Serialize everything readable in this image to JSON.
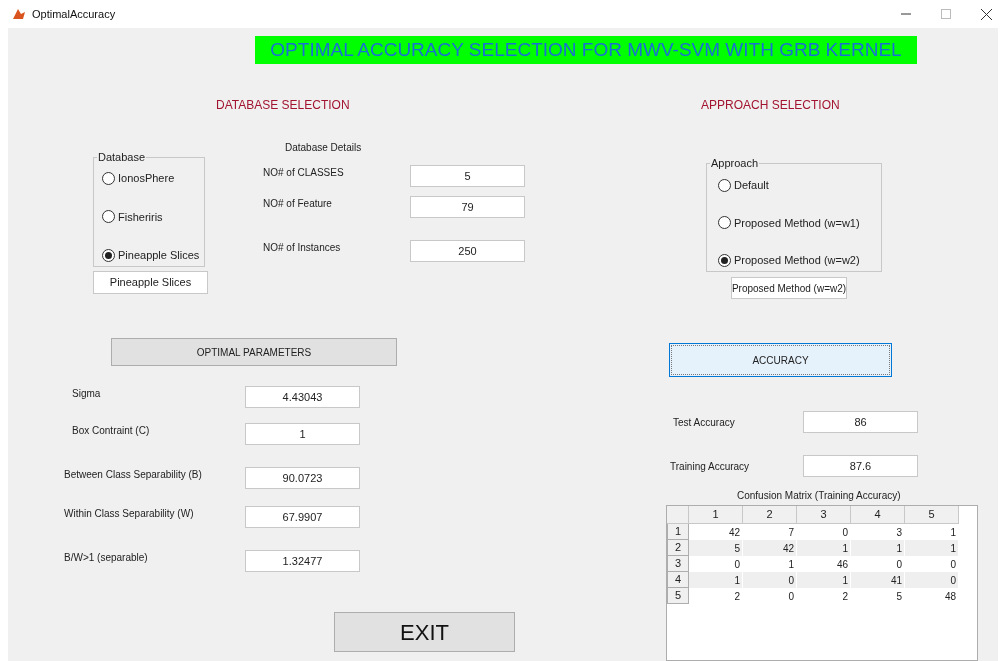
{
  "window": {
    "title": "OptimalAccuracy"
  },
  "banner": "OPTIMAL ACCURACY SELECTION FOR MWV-SVM WITH GRB KERNEL",
  "database_section": {
    "heading": "DATABASE SELECTION",
    "group_title": "Database",
    "options": [
      {
        "label": "IonosPhere",
        "selected": false
      },
      {
        "label": "Fisheriris",
        "selected": false
      },
      {
        "label": "Pineapple Slices",
        "selected": true
      }
    ],
    "selected_display": "Pineapple Slices",
    "details_title": "Database Details",
    "details": [
      {
        "label": "NO# of CLASSES",
        "value": "5"
      },
      {
        "label": "NO# of Feature",
        "value": "79"
      },
      {
        "label": "NO# of Instances",
        "value": "250"
      }
    ]
  },
  "approach_section": {
    "heading": "APPROACH SELECTION",
    "group_title": "Approach",
    "options": [
      {
        "label": "Default",
        "selected": false
      },
      {
        "label": "Proposed Method (w=w1)",
        "selected": false
      },
      {
        "label": "Proposed Method (w=w2)",
        "selected": true
      }
    ],
    "selected_display": "Proposed Method (w=w2)"
  },
  "parameters": {
    "button": "OPTIMAL PARAMETERS",
    "rows": [
      {
        "label": "Sigma",
        "value": "4.43043"
      },
      {
        "label": "Box Contraint (C)",
        "value": "1"
      },
      {
        "label": "Between Class Separability (B)",
        "value": "90.0723"
      },
      {
        "label": "Within Class Separability (W)",
        "value": "67.9907"
      },
      {
        "label": "B/W>1 (separable)",
        "value": "1.32477"
      }
    ]
  },
  "accuracy": {
    "button": "ACCURACY",
    "focused": true,
    "rows": [
      {
        "label": "Test Accuracy",
        "value": "86"
      },
      {
        "label": "Training Accuracy",
        "value": "87.6"
      }
    ]
  },
  "confusion": {
    "title": "Confusion Matrix (Training Accuracy)",
    "columns": [
      "1",
      "2",
      "3",
      "4",
      "5"
    ],
    "rows": [
      {
        "header": "1",
        "cells": [
          "42",
          "7",
          "0",
          "3",
          "1"
        ]
      },
      {
        "header": "2",
        "cells": [
          "5",
          "42",
          "1",
          "1",
          "1"
        ]
      },
      {
        "header": "3",
        "cells": [
          "0",
          "1",
          "46",
          "0",
          "0"
        ]
      },
      {
        "header": "4",
        "cells": [
          "1",
          "0",
          "1",
          "41",
          "0"
        ]
      },
      {
        "header": "5",
        "cells": [
          "2",
          "0",
          "2",
          "5",
          "48"
        ]
      }
    ]
  },
  "exit_button": "EXIT"
}
